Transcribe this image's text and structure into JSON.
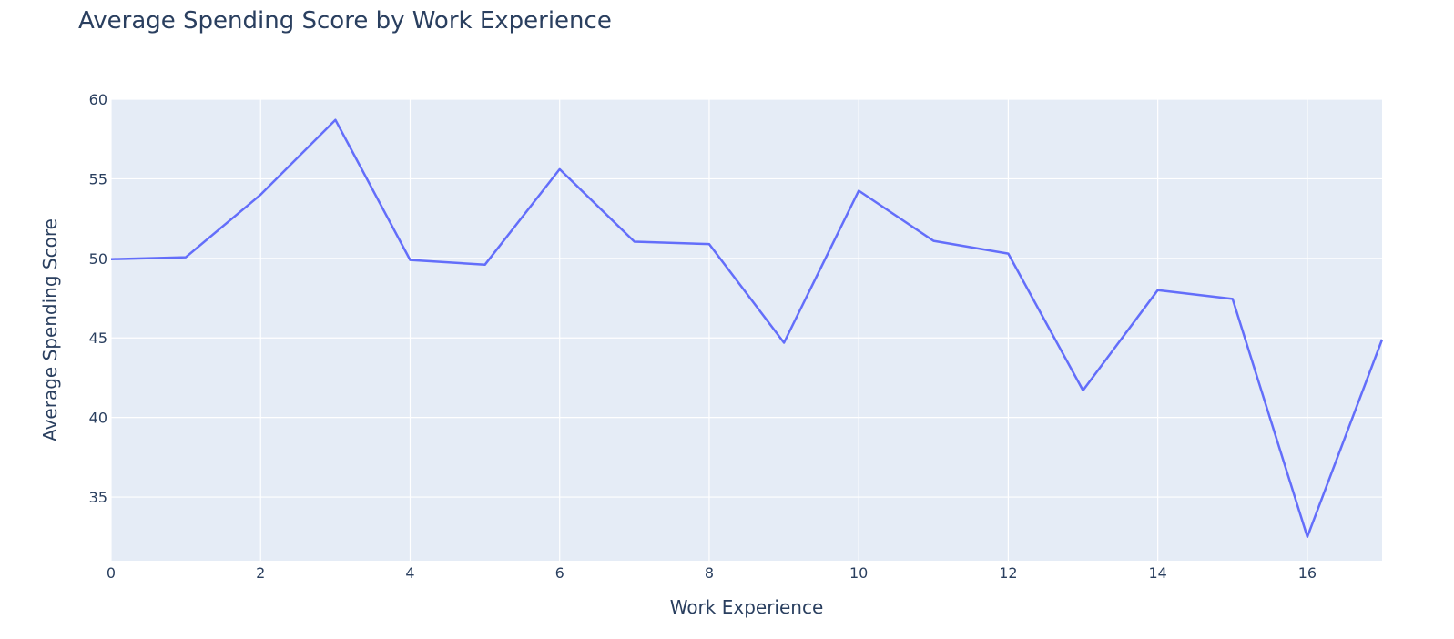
{
  "chart_data": {
    "type": "line",
    "title": "Average Spending Score by Work Experience",
    "xlabel": "Work Experience",
    "ylabel": "Average Spending Score",
    "xlim": [
      0,
      17
    ],
    "ylim": [
      31,
      60
    ],
    "x_ticks": [
      0,
      2,
      4,
      6,
      8,
      10,
      12,
      14,
      16
    ],
    "y_ticks": [
      35,
      40,
      45,
      50,
      55,
      60
    ],
    "grid": true,
    "legend": "none",
    "colors": {
      "line": "#636efa",
      "plot_background": "#e5ecf6",
      "grid": "#ffffff",
      "text": "#2a3f5f"
    },
    "series": [
      {
        "x": [
          0,
          1,
          2,
          3,
          4,
          5,
          6,
          7,
          8,
          9,
          10,
          11,
          12,
          13,
          14,
          15,
          16,
          17
        ],
        "y": [
          49.95,
          50.07,
          54.0,
          58.7,
          49.9,
          49.6,
          55.6,
          51.05,
          50.9,
          44.7,
          54.25,
          51.1,
          50.3,
          41.7,
          48.0,
          47.45,
          32.5,
          44.9
        ]
      }
    ]
  }
}
